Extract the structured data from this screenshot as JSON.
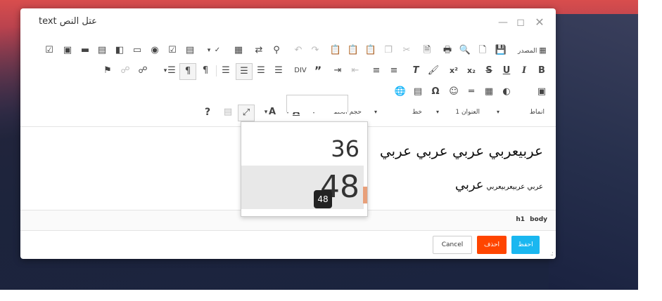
{
  "window": {
    "title": "text عتل النص"
  },
  "toolbar": {
    "row1": {
      "source_label": "المصدر"
    },
    "row4": {
      "styles_label": "انماط",
      "heading_label": "العنوان 1",
      "font_label": "خط",
      "font_size_label": "حجم الخط"
    }
  },
  "editor": {
    "h1_text": "عربيعربي عربي عربي عربي",
    "p_small_text": "عربي عربيعربيعربي",
    "p_big_text": "عربي"
  },
  "font_size_dropdown": {
    "items": [
      {
        "label": "36"
      },
      {
        "label": "48"
      }
    ],
    "tooltip": "48"
  },
  "statusbar": {
    "path": [
      "body",
      "h1"
    ]
  },
  "footer": {
    "save_label": "احفظ",
    "delete_label": "احذف",
    "cancel_label": "Cancel"
  },
  "colors": {
    "save": "#1ab7f0",
    "delete": "#ff4500",
    "hover": "#e8e8e8"
  }
}
